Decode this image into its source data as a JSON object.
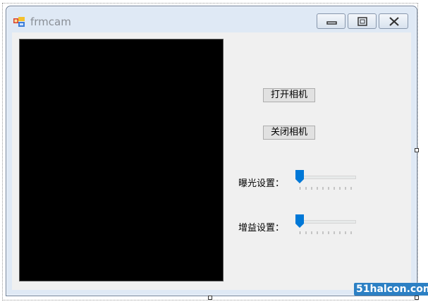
{
  "window": {
    "title": "frmcam"
  },
  "buttons": {
    "open_camera": "打开相机",
    "close_camera": "关闭相机"
  },
  "settings": {
    "exposure_label": "曝光设置：",
    "gain_label": "增益设置：",
    "exposure_value": 0,
    "gain_value": 0
  },
  "watermark": "51halcon.com",
  "colors": {
    "accent": "#0078d7",
    "video_background": "#000000"
  }
}
